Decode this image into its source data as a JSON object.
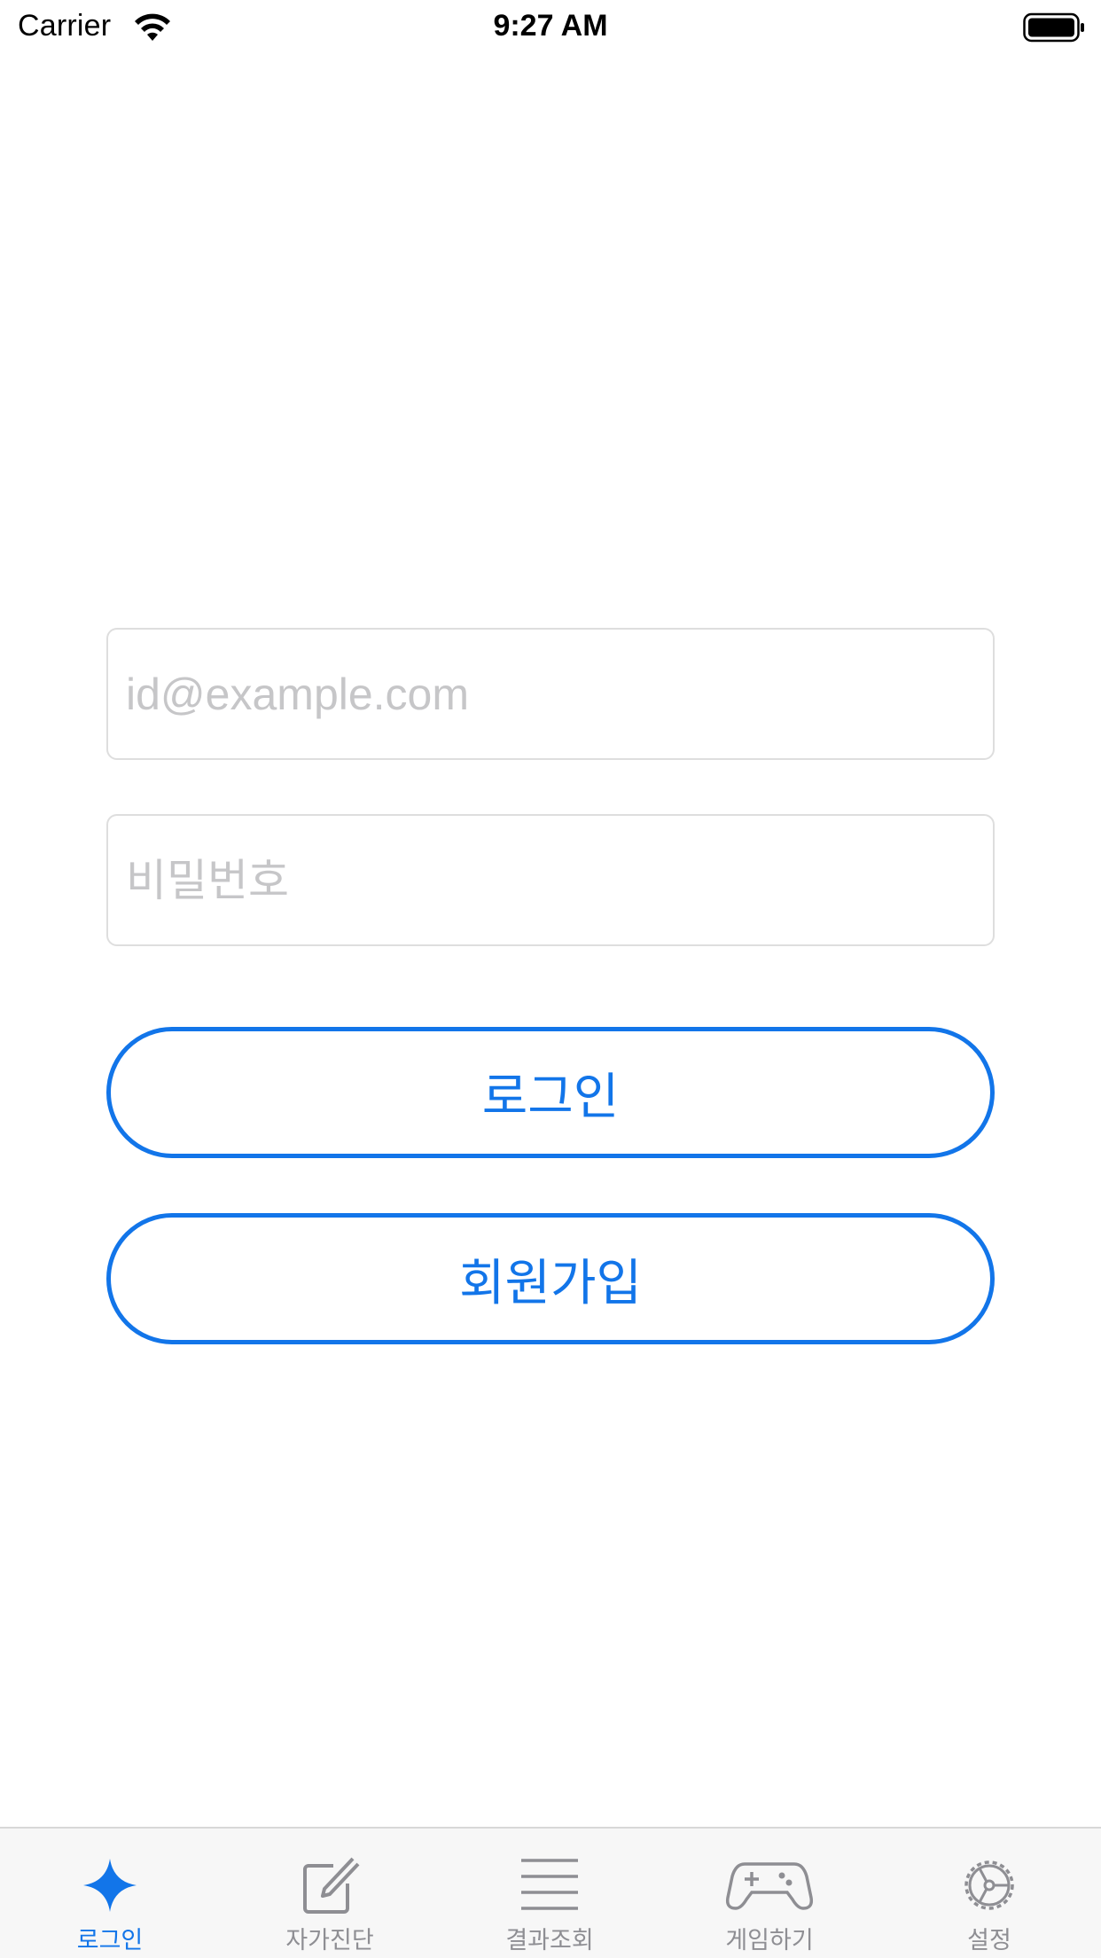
{
  "status_bar": {
    "carrier": "Carrier",
    "time": "9:27 AM"
  },
  "form": {
    "email_placeholder": "id@example.com",
    "password_placeholder": "비밀번호",
    "login_label": "로그인",
    "signup_label": "회원가입"
  },
  "tabs": [
    {
      "label": "로그인",
      "icon": "sparkle-icon",
      "active": true
    },
    {
      "label": "자가진단",
      "icon": "compose-icon",
      "active": false
    },
    {
      "label": "결과조회",
      "icon": "list-icon",
      "active": false
    },
    {
      "label": "게임하기",
      "icon": "gamepad-icon",
      "active": false
    },
    {
      "label": "설정",
      "icon": "gear-icon",
      "active": false
    }
  ],
  "colors": {
    "accent": "#1275e9",
    "inactive": "#8e8e93",
    "tab_bar_bg": "#f7f7f7"
  }
}
